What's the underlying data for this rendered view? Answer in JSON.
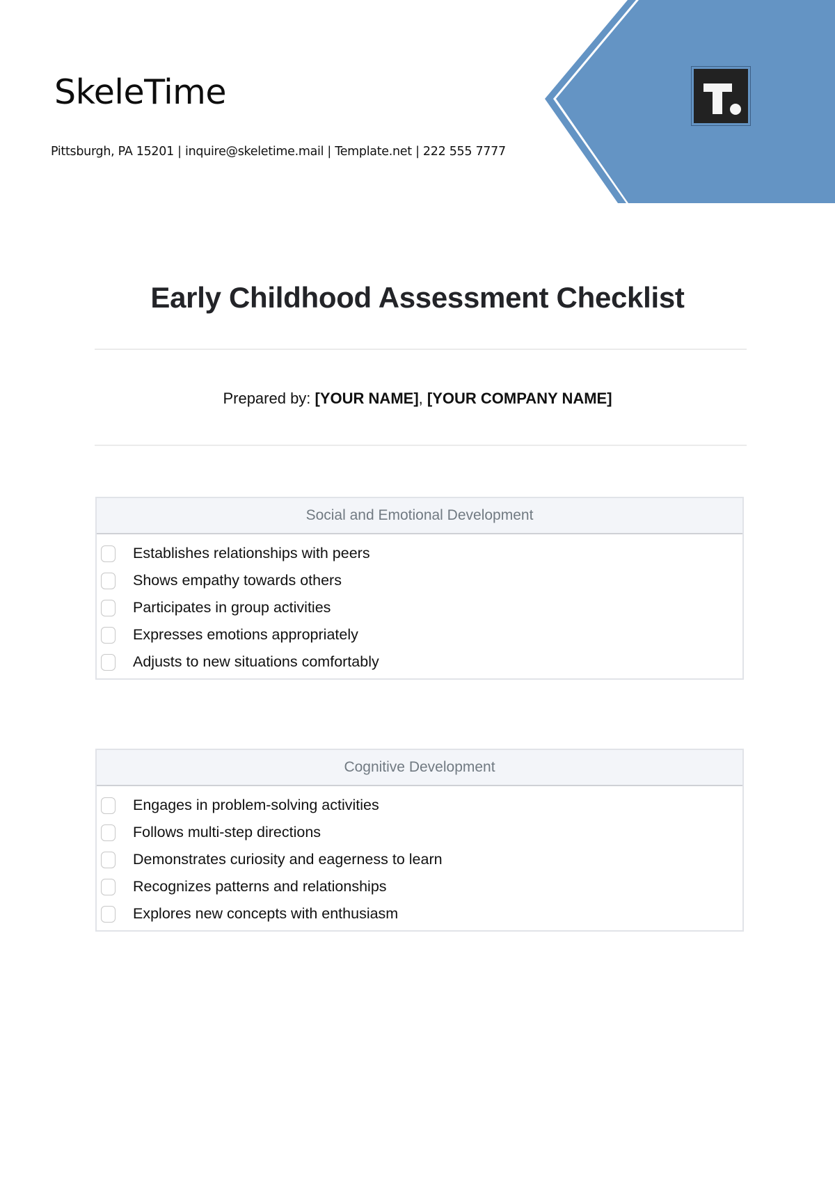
{
  "header": {
    "brand": "SkeleTime",
    "contact": "Pittsburgh, PA 15201 | inquire@skeletime.mail | Template.net | 222 555 7777",
    "logo_icon": "template-t-logo",
    "accent_color": "#6494c4"
  },
  "document": {
    "title": "Early Childhood Assessment Checklist",
    "prepared_by_label": "Prepared by:",
    "prepared_name": "[YOUR NAME]",
    "prepared_separator": ",",
    "prepared_company": "[YOUR COMPANY NAME]"
  },
  "sections": [
    {
      "title": "Social and Emotional Development",
      "items": [
        {
          "label": "Establishes relationships with peers",
          "checked": false
        },
        {
          "label": "Shows empathy towards others",
          "checked": false
        },
        {
          "label": "Participates in group activities",
          "checked": false
        },
        {
          "label": "Expresses emotions appropriately",
          "checked": false
        },
        {
          "label": "Adjusts to new situations comfortably",
          "checked": false
        }
      ]
    },
    {
      "title": "Cognitive Development",
      "items": [
        {
          "label": "Engages in problem-solving activities",
          "checked": false
        },
        {
          "label": "Follows multi-step directions",
          "checked": false
        },
        {
          "label": "Demonstrates curiosity and eagerness to learn",
          "checked": false
        },
        {
          "label": "Recognizes patterns and relationships",
          "checked": false
        },
        {
          "label": "Explores new concepts with enthusiasm",
          "checked": false
        }
      ]
    }
  ]
}
